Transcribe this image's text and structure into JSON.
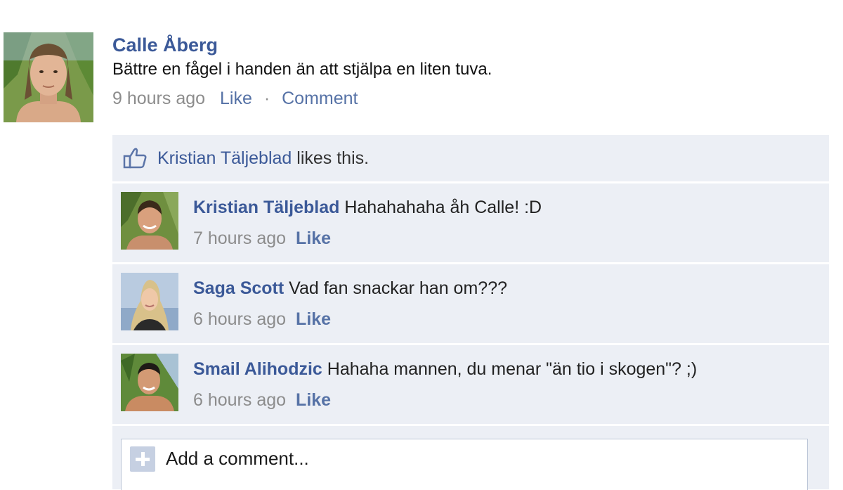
{
  "post": {
    "author": "Calle Åberg",
    "message": "Bättre en fågel i handen än att stjälpa en liten tuva.",
    "time": "9 hours ago",
    "like_label": "Like",
    "separator": "·",
    "comment_label": "Comment"
  },
  "likes": {
    "name": "Kristian Täljeblad",
    "suffix": " likes this.",
    "icon": "thumbs-up-icon"
  },
  "comments": [
    {
      "name": "Kristian Täljeblad",
      "text": " Hahahahaha åh Calle! :D",
      "time": "7 hours ago",
      "like_label": "Like"
    },
    {
      "name": "Saga Scott",
      "text": " Vad fan snackar han om???",
      "time": "6 hours ago",
      "like_label": "Like"
    },
    {
      "name": "Smail Alihodzic",
      "text": " Hahaha mannen, du menar \"än tio i skogen\"? ;)",
      "time": "6 hours ago",
      "like_label": "Like"
    }
  ],
  "add_comment": {
    "placeholder": "Add a comment..."
  },
  "colors": {
    "link": "#3b5998",
    "ufi_background": "#eceff5",
    "meta_gray": "#8c8c8c"
  }
}
